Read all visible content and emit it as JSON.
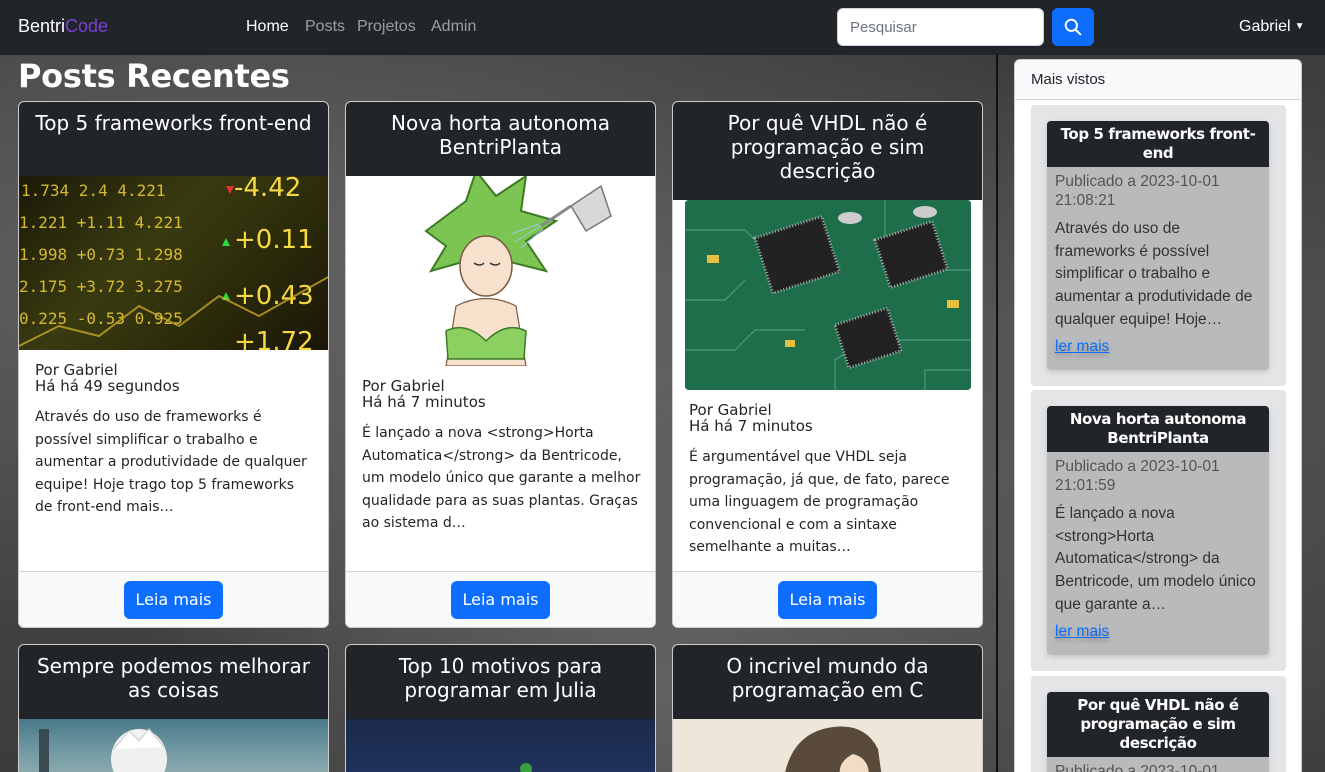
{
  "navbar": {
    "brand_a": "Bentri",
    "brand_b": "Code",
    "links": [
      "Home",
      "Posts",
      "Projetos",
      "Admin"
    ],
    "search_placeholder": "Pesquisar",
    "user": "Gabriel"
  },
  "main": {
    "title": "Posts Recentes",
    "posts": [
      {
        "title": "Top 5 frameworks front-end",
        "author": "Por Gabriel",
        "time": "Há há 49 segundos",
        "excerpt": "Através do uso de frameworks é possível simplificar o trabalho e aumentar a produtividade de qualquer equipe! Hoje trago top 5 frameworks de front-end mais…",
        "button": "Leia mais",
        "image_icon": "stock-ticker-image"
      },
      {
        "title": "Nova horta autonoma BentriPlanta",
        "author": "Por Gabriel",
        "time": "Há há 7 minutos",
        "excerpt": "É lançado a nova <strong>Horta Automatica</strong> da Bentricode, um modelo único que garante a melhor qualidade para as suas plantas. Graças ao sistema d…",
        "button": "Leia mais",
        "image_icon": "plant-girl-image"
      },
      {
        "title": "Por quê VHDL não é programação e sim descrição",
        "author": "Por Gabriel",
        "time": "Há há 7 minutos",
        "excerpt": "É argumentável que VHDL seja programação, já que, de fato, parece uma linguagem de programação convencional e com a sintaxe semelhante a muitas…",
        "button": "Leia mais",
        "image_icon": "circuit-board-image"
      },
      {
        "title": "Sempre podemos melhorar as coisas",
        "image_icon": "anime-character-image"
      },
      {
        "title": "Top 10 motivos para programar em Julia",
        "image_icon": "julia-logo-image"
      },
      {
        "title": "O incrivel mundo da programação em C",
        "image_icon": "anime-boy-image"
      }
    ]
  },
  "sidebar": {
    "header": "Mais vistos",
    "items": [
      {
        "title": "Top 5 frameworks front-end",
        "date": "Publicado a 2023-10-01 21:08:21",
        "text": "Através do uso de frameworks é possível simplificar o trabalho e aumentar a produtividade de qualquer equipe! Hoje…",
        "link": "ler mais"
      },
      {
        "title": "Nova horta autonoma BentriPlanta",
        "date": "Publicado a 2023-10-01 21:01:59",
        "text": "É lançado a nova <strong>Horta Automatica</strong> da Bentricode, um modelo único que garante a…",
        "link": "ler mais"
      },
      {
        "title": "Por quê VHDL não é programação e sim descrição",
        "date": "Publicado a 2023-10-01"
      }
    ]
  },
  "colors": {
    "navbar": "#212529",
    "brand_accent": "#7a3fd4",
    "primary": "#0d6efd"
  }
}
